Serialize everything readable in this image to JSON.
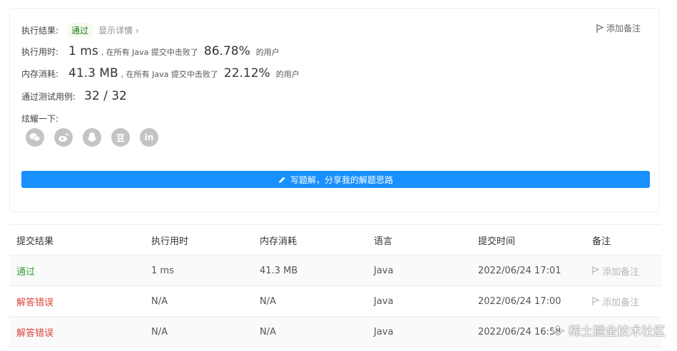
{
  "result": {
    "label": "执行结果:",
    "status": "通过",
    "details": "显示详情 ›",
    "add_note": "添加备注"
  },
  "runtime": {
    "label": "执行用时:",
    "value": "1 ms",
    "middle": ", 在所有 Java 提交中击败了",
    "percent": "86.78%",
    "suffix": "的用户"
  },
  "memory": {
    "label": "内存消耗:",
    "value": "41.3 MB",
    "middle": ", 在所有 Java 提交中击败了",
    "percent": "22.12%",
    "suffix": "的用户"
  },
  "tests": {
    "label": "通过测试用例:",
    "value": "32 / 32"
  },
  "share": {
    "label": "炫耀一下:",
    "icons": [
      "wechat-icon",
      "weibo-icon",
      "qq-icon",
      "douban-icon",
      "linkedin-icon"
    ],
    "douban_glyph": "豆",
    "linkedin_glyph": "in"
  },
  "write_solution": "写题解，分享我的解题思路",
  "table": {
    "headers": [
      "提交结果",
      "执行用时",
      "内存消耗",
      "语言",
      "提交时间",
      "备注"
    ],
    "rows": [
      {
        "result": "通过",
        "runtime": "1 ms",
        "memory": "41.3 MB",
        "language": "Java",
        "time": "2022/06/24 17:01",
        "note": "添加备注",
        "status": "ok"
      },
      {
        "result": "解答错误",
        "runtime": "N/A",
        "memory": "N/A",
        "language": "Java",
        "time": "2022/06/24 17:00",
        "note": "添加备注",
        "status": "err"
      },
      {
        "result": "解答错误",
        "runtime": "N/A",
        "memory": "N/A",
        "language": "Java",
        "time": "2022/06/24 16:58",
        "note": "",
        "status": "err"
      }
    ]
  },
  "watermark": "稀土掘金技术社区",
  "colors": {
    "accent": "#1890ff",
    "success": "#3a9f3a",
    "error": "#d9453b"
  }
}
